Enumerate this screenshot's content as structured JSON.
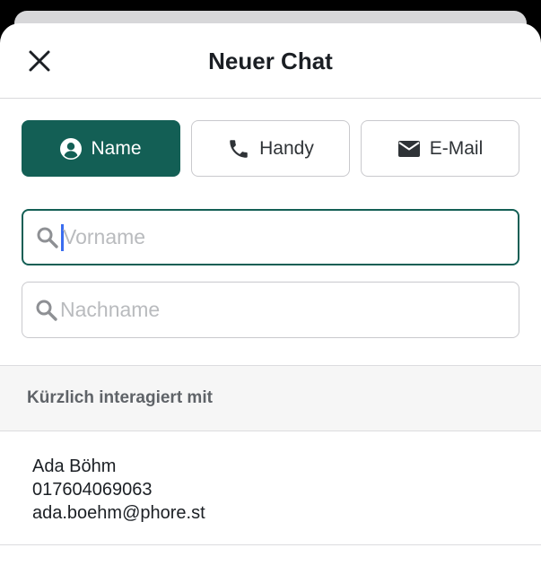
{
  "header": {
    "title": "Neuer Chat"
  },
  "segments": [
    {
      "label": "Name",
      "icon": "person-circle-icon",
      "active": true
    },
    {
      "label": "Handy",
      "icon": "phone-icon",
      "active": false
    },
    {
      "label": "E-Mail",
      "icon": "envelope-icon",
      "active": false
    }
  ],
  "fields": {
    "first_name": {
      "placeholder": "Vorname",
      "value": ""
    },
    "last_name": {
      "placeholder": "Nachname",
      "value": ""
    }
  },
  "recent": {
    "header": "Kürzlich interagiert mit",
    "contacts": [
      {
        "name": "Ada Böhm",
        "phone": "017604069063",
        "email": "ada.boehm@phore.st"
      }
    ]
  },
  "colors": {
    "accent": "#135f55",
    "caret": "#3a6df0"
  }
}
